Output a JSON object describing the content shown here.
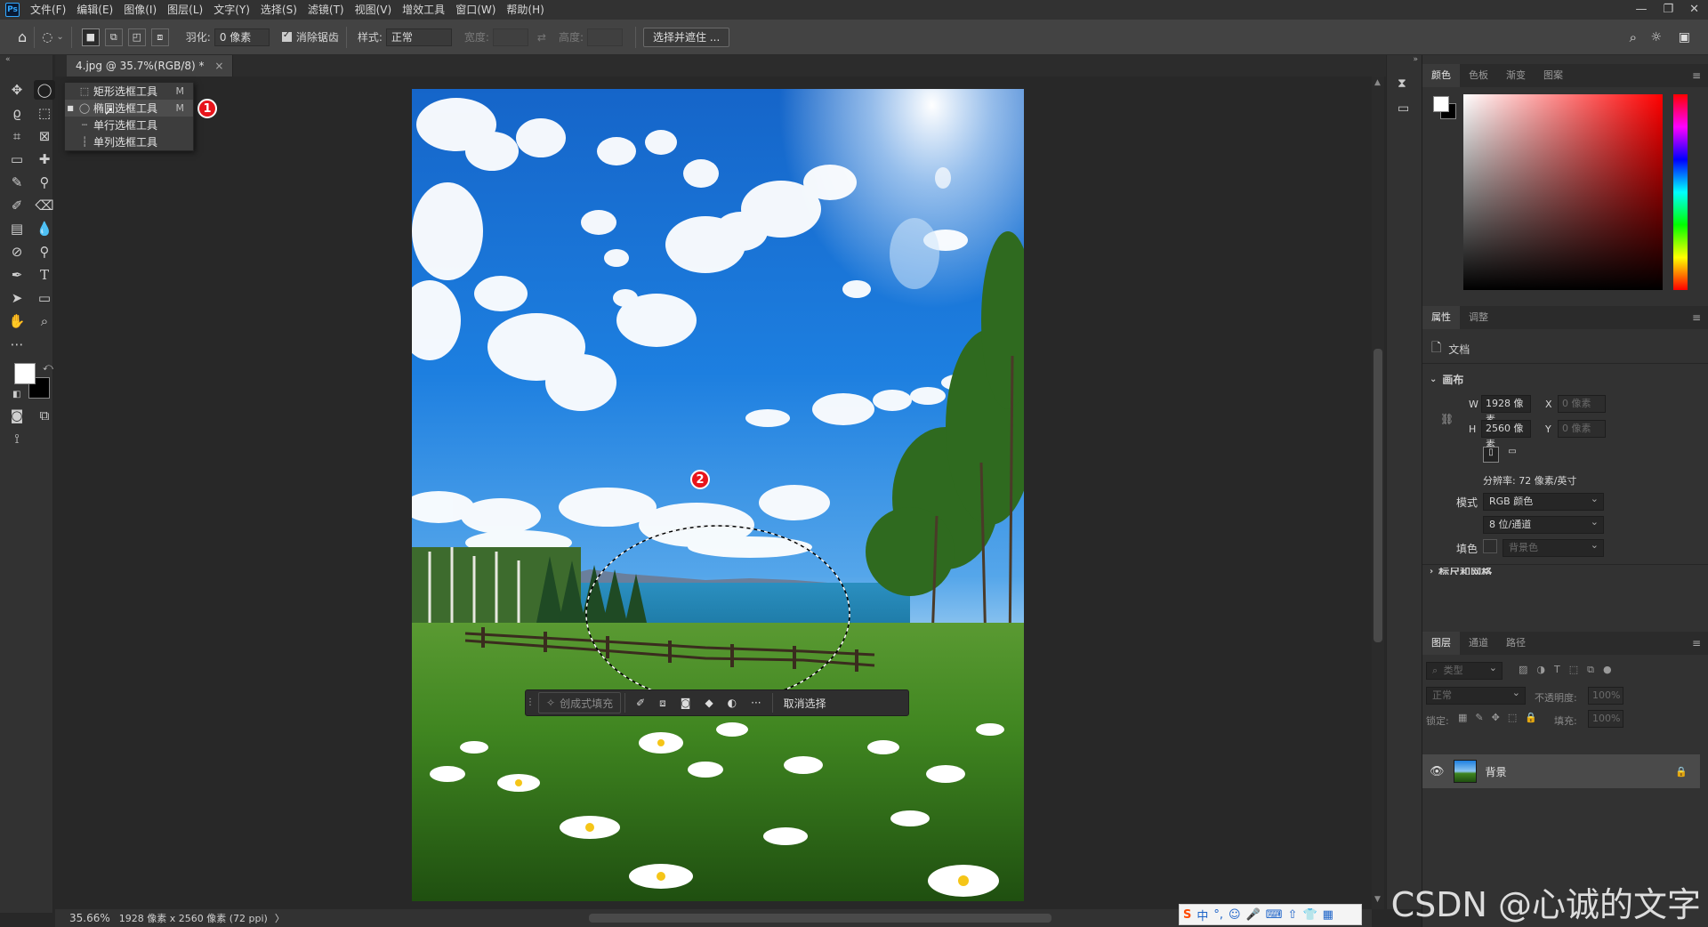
{
  "app": {
    "logo": "Ps",
    "menu": [
      "文件(F)",
      "编辑(E)",
      "图像(I)",
      "图层(L)",
      "文字(Y)",
      "选择(S)",
      "滤镜(T)",
      "视图(V)",
      "增效工具",
      "窗口(W)",
      "帮助(H)"
    ],
    "window_controls": [
      "—",
      "❐",
      "✕"
    ]
  },
  "options_bar": {
    "feather_label": "羽化:",
    "feather_value": "0 像素",
    "antialias_label": "消除锯齿",
    "style_label": "样式:",
    "style_value": "正常",
    "width_label": "宽度:",
    "height_label": "高度:",
    "select_mask_button": "选择并遮住 ..."
  },
  "document": {
    "tab_title": "4.jpg @ 35.7%(RGB/8) *",
    "close_glyph": "×"
  },
  "flyout": {
    "items": [
      {
        "label": "矩形选框工具",
        "shortcut": "M",
        "icon": "⬚",
        "selected": false
      },
      {
        "label": "椭圆选框工具",
        "shortcut": "M",
        "icon": "◯",
        "selected": true
      },
      {
        "label": "单行选框工具",
        "shortcut": "",
        "icon": "┄",
        "selected": false
      },
      {
        "label": "单列选框工具",
        "shortcut": "",
        "icon": "┆",
        "selected": false
      }
    ],
    "badge_1": "1",
    "badge_2": "2"
  },
  "task_bar": {
    "generative_fill": "创成式填充",
    "more": "···",
    "deselect": "取消选择"
  },
  "status_bar": {
    "zoom": "35.66%",
    "doc_info": "1928 像素 x 2560 像素 (72 ppi)",
    "arrow": "〉"
  },
  "color_panel": {
    "tabs": [
      "颜色",
      "色板",
      "渐变",
      "图案"
    ],
    "hue_color": "#ff0000"
  },
  "properties_panel": {
    "tabs": [
      "属性",
      "调整"
    ],
    "doc_label": "文档",
    "canvas_section": "画布",
    "w_label": "W",
    "w_value": "1928 像素",
    "h_label": "H",
    "h_value": "2560 像素",
    "x_label": "X",
    "x_placeholder": "0 像素",
    "y_label": "Y",
    "y_placeholder": "0 像素",
    "resolution": "分辨率: 72 像素/英寸",
    "mode_label": "模式",
    "mode_value": "RGB 颜色",
    "depth_value": "8 位/通道",
    "fill_label": "填色",
    "fill_value": "背景色",
    "next_section": "标尺和网格"
  },
  "layers_panel": {
    "tabs": [
      "图层",
      "通道",
      "路径"
    ],
    "filter_placeholder": "类型",
    "blend_mode": "正常",
    "opacity_label": "不透明度:",
    "opacity_value": "100%",
    "lock_label": "锁定:",
    "fill_label": "填充:",
    "fill_value": "100%",
    "layer_name": "背景"
  },
  "ime_bar": {
    "items": [
      "S",
      "中",
      "°,",
      "☺",
      "🎤",
      "⌨",
      "⇧",
      "👕",
      "▦"
    ]
  },
  "watermark": "CSDN @心诚的文字"
}
